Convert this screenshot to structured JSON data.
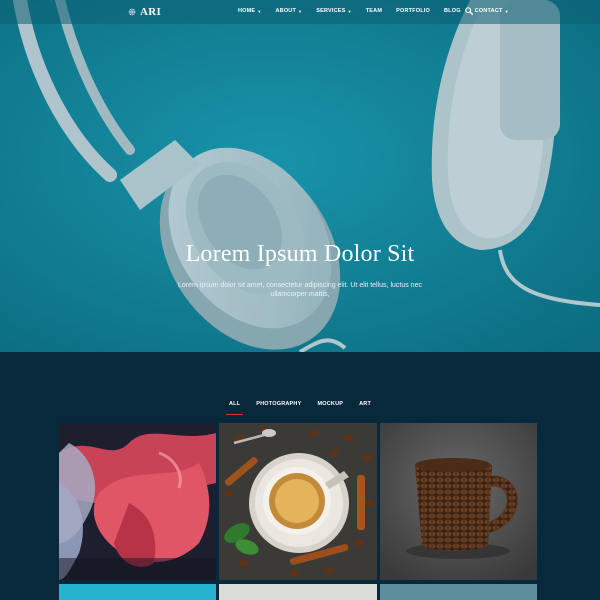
{
  "nav": {
    "brand": "ARI",
    "items": [
      {
        "label": "HOME",
        "dropdown": true
      },
      {
        "label": "ABOUT",
        "dropdown": true
      },
      {
        "label": "SERVICES",
        "dropdown": true
      },
      {
        "label": "TEAM",
        "dropdown": false
      },
      {
        "label": "PORTFOLIO",
        "dropdown": false
      },
      {
        "label": "BLOG",
        "dropdown": false
      },
      {
        "label": "CONTACT",
        "dropdown": true
      }
    ],
    "search_icon": "search-icon"
  },
  "hero": {
    "title": "Lorem Ipsum Dolor Sit",
    "subtitle": "Lorem ipsum dolor sit amet, consectetur adipiscing elit. Ut elit tellus, luctus nec ullamcorper mattis,"
  },
  "portfolio": {
    "filters": [
      "ALL",
      "PHOTOGRAPHY",
      "MOCKUP",
      "ART"
    ],
    "active_filter": "ALL",
    "items": [
      "ink smoke in water",
      "coffee cup with beans and cinnamon",
      "mug made of coffee beans"
    ]
  },
  "colors": {
    "hero_bg": "#138aa0",
    "page_bg": "#08283b",
    "accent": "#d8312e"
  }
}
